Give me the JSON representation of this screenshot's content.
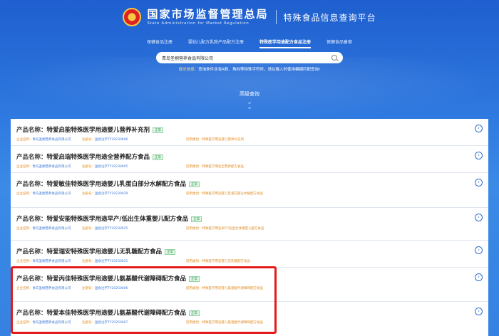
{
  "header": {
    "agency_cn": "国家市场监督管理总局",
    "agency_en": "State Administration for Market Regulation",
    "platform": "特殊食品信息查询平台"
  },
  "nav": {
    "items": [
      "保健食品注册",
      "婴幼儿配方乳粉产品配方注册",
      "特殊医学用途配方食品注册",
      "保健食品备案"
    ],
    "active_index": 2
  },
  "search": {
    "value": "青岛圣桐营养食品有限公司"
  },
  "hint": {
    "label": "提示信息：",
    "text": "查询条件含有R和、角标等特殊字符时，请在输入时使用模糊匹配查询!"
  },
  "advanced": {
    "label": "高级查询"
  },
  "results": [
    {
      "prefix": "产品名称：",
      "name": "特爱启能特殊医学用途婴儿营养补充剂",
      "badge": "正常",
      "company_label": "企业名称：",
      "company": "青岛圣桐营养食品有限公司",
      "reg_label": "注册号：",
      "reg": "国食注字TY20230006",
      "cat_label": "适用类别：",
      "category": "特殊医学用途婴儿营养补充剂"
    },
    {
      "prefix": "产品名称：",
      "name": "特爱启瑞特殊医学用途全营养配方食品",
      "badge": "正常",
      "company_label": "企业名称：",
      "company": "青岛圣桐营养食品有限公司",
      "reg_label": "注册号：",
      "reg": "国食注字TY20230005",
      "cat_label": "适用类别：",
      "category": "特殊医学用途全营养配方食品"
    },
    {
      "prefix": "产品名称：",
      "name": "特爱敏佳特殊医学用途婴儿乳蛋白部分水解配方食品",
      "badge": "正常",
      "company_label": "企业名称：",
      "company": "青岛圣桐营养食品有限公司",
      "reg_label": "注册号：",
      "reg": "国食注字TY20230029",
      "cat_label": "适用类别：",
      "category": "特殊医学用途婴儿乳蛋白部分水解配方食品"
    },
    {
      "prefix": "产品名称：",
      "name": "特爱安能特殊医学用途早产/低出生体重婴儿配方食品",
      "badge": "正常",
      "company_label": "企业名称：",
      "company": "青岛圣桐营养食品有限公司",
      "reg_label": "注册号：",
      "reg": "国食注字TY20230025",
      "cat_label": "适用类别：",
      "category": "特殊医学用途早产/低出生体重婴儿配方食品"
    },
    {
      "prefix": "产品名称：",
      "name": "特爱瑞安特殊医学用途婴儿无乳糖配方食品",
      "badge": "正常",
      "company_label": "企业名称：",
      "company": "青岛圣桐营养食品有限公司",
      "reg_label": "注册号：",
      "reg": "国食注字TY20230021",
      "cat_label": "适用类别：",
      "category": "特殊医学用途婴儿无乳糖配方食品"
    },
    {
      "prefix": "产品名称：",
      "name": "特爱丙佳特殊医学用途婴儿氨基酸代谢障碍配方食品",
      "badge": "正常",
      "company_label": "企业名称：",
      "company": "青岛圣桐营养食品有限公司",
      "reg_label": "注册号：",
      "reg": "国食注字TY20250006",
      "cat_label": "适用类别：",
      "category": "特殊医学用途婴儿氨基酸代谢障碍配方食品"
    },
    {
      "prefix": "产品名称：",
      "name": "特爱本佳特殊医学用途婴儿氨基酸代谢障碍配方食品",
      "badge": "正常",
      "company_label": "企业名称：",
      "company": "青岛圣桐营养食品有限公司",
      "reg_label": "注册号：",
      "reg": "国食注字TY20250007",
      "cat_label": "适用类别：",
      "category": "特殊医学用途婴儿氨基酸代谢障碍配方食品"
    }
  ],
  "colors": {
    "highlight": "#e31b1b",
    "accent": "#2f6fd6",
    "meta_orange": "#e08a1e"
  }
}
